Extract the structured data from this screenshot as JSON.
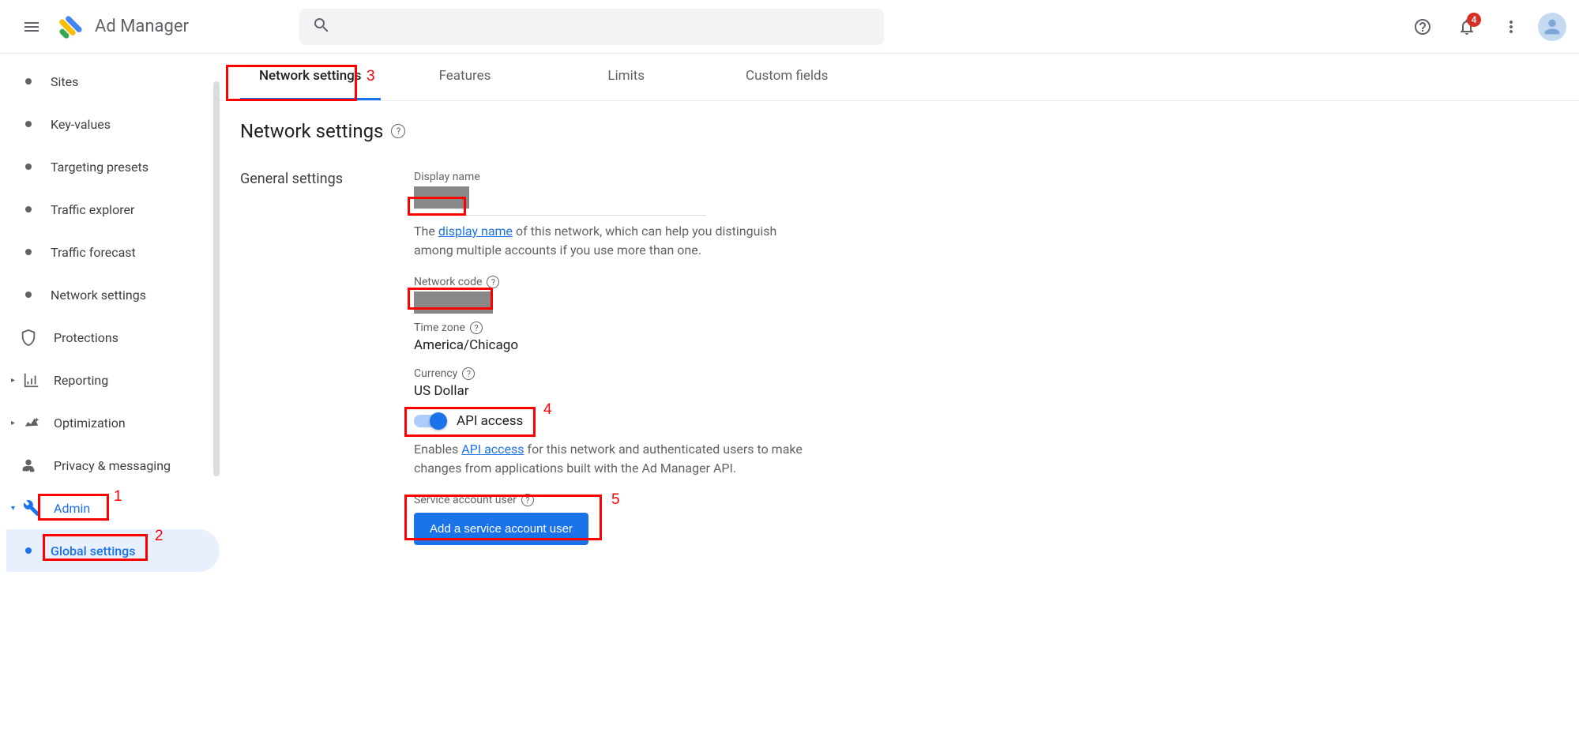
{
  "header": {
    "app_title": "Ad Manager",
    "notif_count": "4"
  },
  "sidebar": {
    "items": [
      {
        "label": "Sites",
        "type": "bullet"
      },
      {
        "label": "Key-values",
        "type": "bullet"
      },
      {
        "label": "Targeting presets",
        "type": "bullet"
      },
      {
        "label": "Traffic explorer",
        "type": "bullet"
      },
      {
        "label": "Traffic forecast",
        "type": "bullet"
      },
      {
        "label": "Network settings",
        "type": "bullet"
      },
      {
        "label": "Protections",
        "type": "shield"
      },
      {
        "label": "Reporting",
        "type": "chart"
      },
      {
        "label": "Optimization",
        "type": "spark"
      },
      {
        "label": "Privacy & messaging",
        "type": "privacy"
      },
      {
        "label": "Admin",
        "type": "wrench",
        "blue": true
      },
      {
        "label": "Global settings",
        "type": "bullet-blue",
        "active": true
      }
    ]
  },
  "tabs": [
    {
      "label": "Network settings",
      "active": true
    },
    {
      "label": "Features"
    },
    {
      "label": "Limits"
    },
    {
      "label": "Custom fields"
    }
  ],
  "page_title": "Network settings",
  "section_label": "General settings",
  "fields": {
    "display_name": {
      "label": "Display name",
      "help_prefix": "The ",
      "help_link": "display name",
      "help_suffix": " of this network, which can help you distinguish among multiple accounts if you use more than one."
    },
    "network_code": {
      "label": "Network code"
    },
    "time_zone": {
      "label": "Time zone",
      "value": "America/Chicago"
    },
    "currency": {
      "label": "Currency",
      "value": "US Dollar"
    },
    "api_access": {
      "label": "API access",
      "help_prefix": "Enables ",
      "help_link": "API access",
      "help_suffix": " for this network and authenticated users to make changes from applications built with the Ad Manager API."
    },
    "service_account": {
      "label": "Service account user",
      "button": "Add a service account user"
    }
  },
  "callouts": {
    "1": "1",
    "2": "2",
    "3": "3",
    "4": "4",
    "5": "5"
  }
}
